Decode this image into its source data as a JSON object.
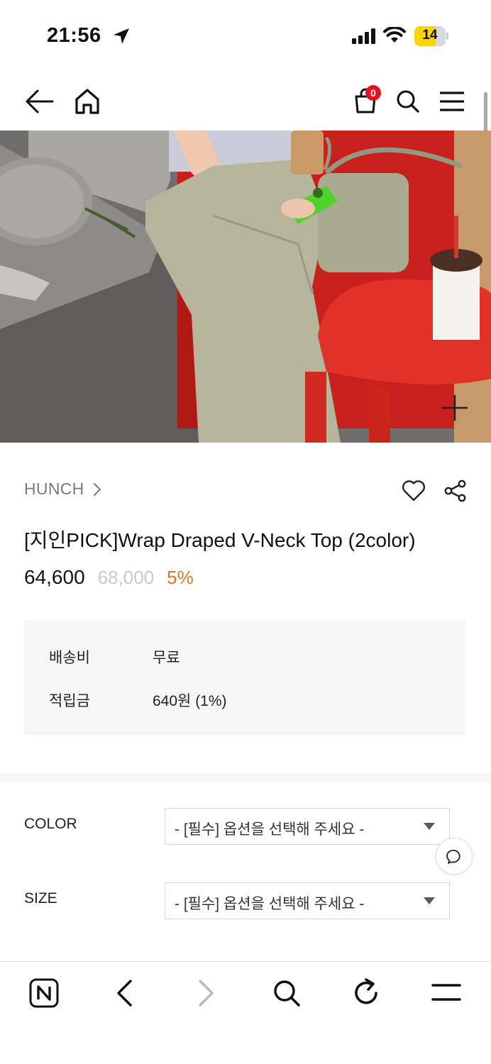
{
  "status_bar": {
    "time": "21:56",
    "battery": "14"
  },
  "nav": {
    "cart_count": "0",
    "icons": [
      "back-arrow-icon",
      "home-icon",
      "cart-icon",
      "search-icon",
      "menu-icon"
    ]
  },
  "image": {
    "alt": "Model wearing beige wide pants seated on a red chair beside a red side table with an iced coffee",
    "zoom_icon": "plus-icon"
  },
  "product": {
    "brand": "HUNCH",
    "title": "[지인PICK]Wrap Draped V-Neck Top (2color)",
    "price": "64,600",
    "original_price": "68,000",
    "discount": "5%"
  },
  "info": {
    "shipping_label": "배송비",
    "shipping_value": "무료",
    "points_label": "적립금",
    "points_value": "640원 (1%)"
  },
  "options": [
    {
      "label": "COLOR",
      "placeholder": "- [필수] 옵션을 선택해 주세요 -"
    },
    {
      "label": "SIZE",
      "placeholder": "- [필수] 옵션을 선택해 주세요 -"
    }
  ],
  "bottom_bar": {
    "icons": [
      "naver-n-icon",
      "browser-back-icon",
      "browser-forward-icon",
      "browser-search-icon",
      "reload-icon",
      "browser-menu-icon"
    ]
  },
  "colors": {
    "discount": "#e0752d",
    "original_price": "#c9c9c9",
    "badge": "#e8101c",
    "battery": "#fad300",
    "info_bg": "#f6f6f6"
  }
}
